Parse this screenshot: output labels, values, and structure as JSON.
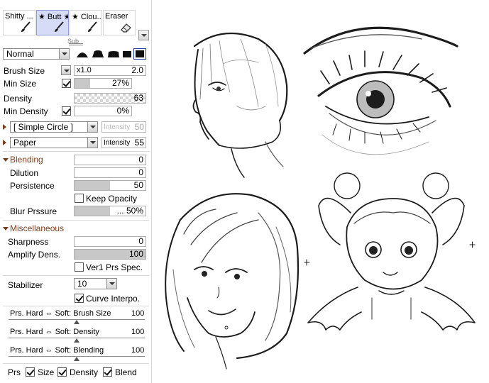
{
  "tools": [
    {
      "label": "Shitty ...",
      "selected": false,
      "icon": "brush-icon"
    },
    {
      "label": "★ Butt ★",
      "selected": true,
      "icon": "brush-icon"
    },
    {
      "label": "★ Clou...",
      "selected": false,
      "icon": "brush-icon"
    },
    {
      "label": "Eraser",
      "selected": false,
      "icon": "eraser-icon"
    }
  ],
  "tools_subtext": "Sub",
  "blend_mode": "Normal",
  "brush_size": {
    "label": "Brush Size",
    "multiplier": "x1.0",
    "value": "2.0"
  },
  "min_size": {
    "label": "Min Size",
    "checked": true,
    "value": "27%",
    "fraction": 0.27
  },
  "density": {
    "label": "Density",
    "value": "63"
  },
  "min_density": {
    "label": "Min Density",
    "checked": true,
    "value": "0%"
  },
  "brush_shape": {
    "value": "[ Simple Circle ]",
    "intensity_label": "Intensity",
    "intensity": "50"
  },
  "texture": {
    "value": "Paper",
    "intensity_label": "Intensity",
    "intensity": "55"
  },
  "blending": {
    "title": "Blending",
    "blending": {
      "label": "Blending",
      "value": "0"
    },
    "dilution": {
      "label": "Dilution",
      "value": "0"
    },
    "persistence": {
      "label": "Persistence",
      "value": "50",
      "fraction": 0.5
    },
    "keep_opacity": {
      "label": "Keep Opacity",
      "checked": false
    },
    "blur_pressure": {
      "label": "Blur Prssure",
      "value": "... 50%",
      "fraction": 0.5
    }
  },
  "misc": {
    "title": "Miscellaneous",
    "sharpness": {
      "label": "Sharpness",
      "value": "0"
    },
    "amplify": {
      "label": "Amplify Dens.",
      "value": "100",
      "fraction": 1.0
    },
    "ver1": {
      "label": "Ver1 Prs Spec.",
      "checked": false
    }
  },
  "stabilizer": {
    "label": "Stabilizer",
    "value": "10"
  },
  "curve_interp": {
    "label": "Curve Interpo.",
    "checked": true
  },
  "pressure": [
    {
      "label": "Prs. Hard ⇔ Soft: Brush Size",
      "value": "100"
    },
    {
      "label": "Prs. Hard ⇔ Soft: Density",
      "value": "100"
    },
    {
      "label": "Prs. Hard ⇔ Soft: Blending",
      "value": "100"
    }
  ],
  "bottom": {
    "prs": "Prs",
    "size": "Size",
    "density": "Density",
    "blend": "Blend"
  },
  "colors": {
    "selected_tool": "#d6dcf6",
    "section": "#7a3d1e",
    "slider_fill": "#c8c8c8"
  }
}
